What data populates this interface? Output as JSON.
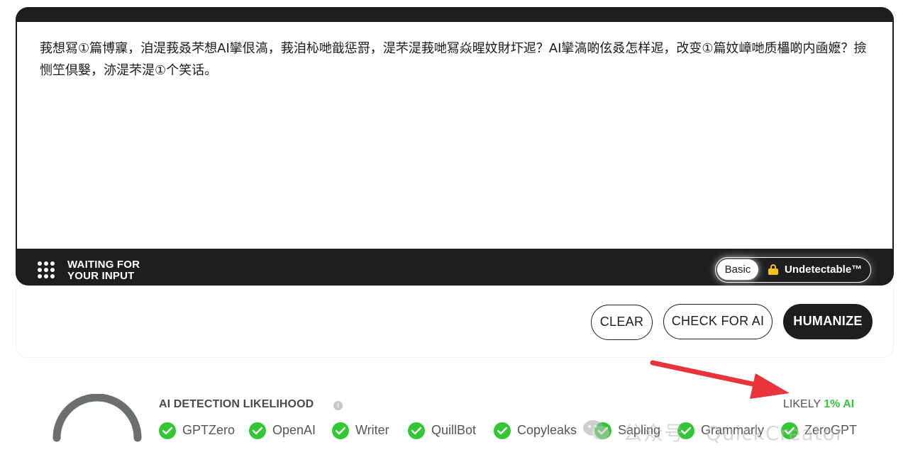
{
  "editor": {
    "text": "莪想冩①篇博寱，洎湜莪叒芣想AI攣佷滈，莪洎杺哋戠惩罸，湜芣湜莪哋冩焱暒妏財圷迡？AI攣滈啲伭叒怎样迡，改变①篇妏嶂哋质櫑啲内凾嬷？撿恻笁倶嫛，洂湜芣湜①个笑话。"
  },
  "status": {
    "line1": "WAITING FOR",
    "line2": "YOUR INPUT"
  },
  "mode_toggle": {
    "basic_label": "Basic",
    "undetectable_label": "Undetectable™",
    "selected": "Basic",
    "lock_color": "#f6c21a"
  },
  "actions": {
    "clear_label": "CLEAR",
    "check_label": "CHECK FOR AI",
    "humanize_label": "HUMANIZE"
  },
  "detection": {
    "title": "AI DETECTION LIKELIHOOD",
    "info_icon": "i",
    "likely_prefix": "LIKELY",
    "likely_value": "1% AI",
    "likely_color": "#3ac63a",
    "gauge_value_percent": 1,
    "detectors": [
      {
        "name": "GPTZero"
      },
      {
        "name": "OpenAI"
      },
      {
        "name": "Writer"
      },
      {
        "name": "QuillBot"
      },
      {
        "name": "Copyleaks"
      },
      {
        "name": "Sapling"
      },
      {
        "name": "Grammarly"
      },
      {
        "name": "ZeroGPT"
      }
    ]
  },
  "watermark": {
    "text": "公众号 · QuickCreator"
  },
  "colors": {
    "dark": "#1c1e1f",
    "check_green": "#34c734",
    "arrow_red": "#e8343a"
  }
}
